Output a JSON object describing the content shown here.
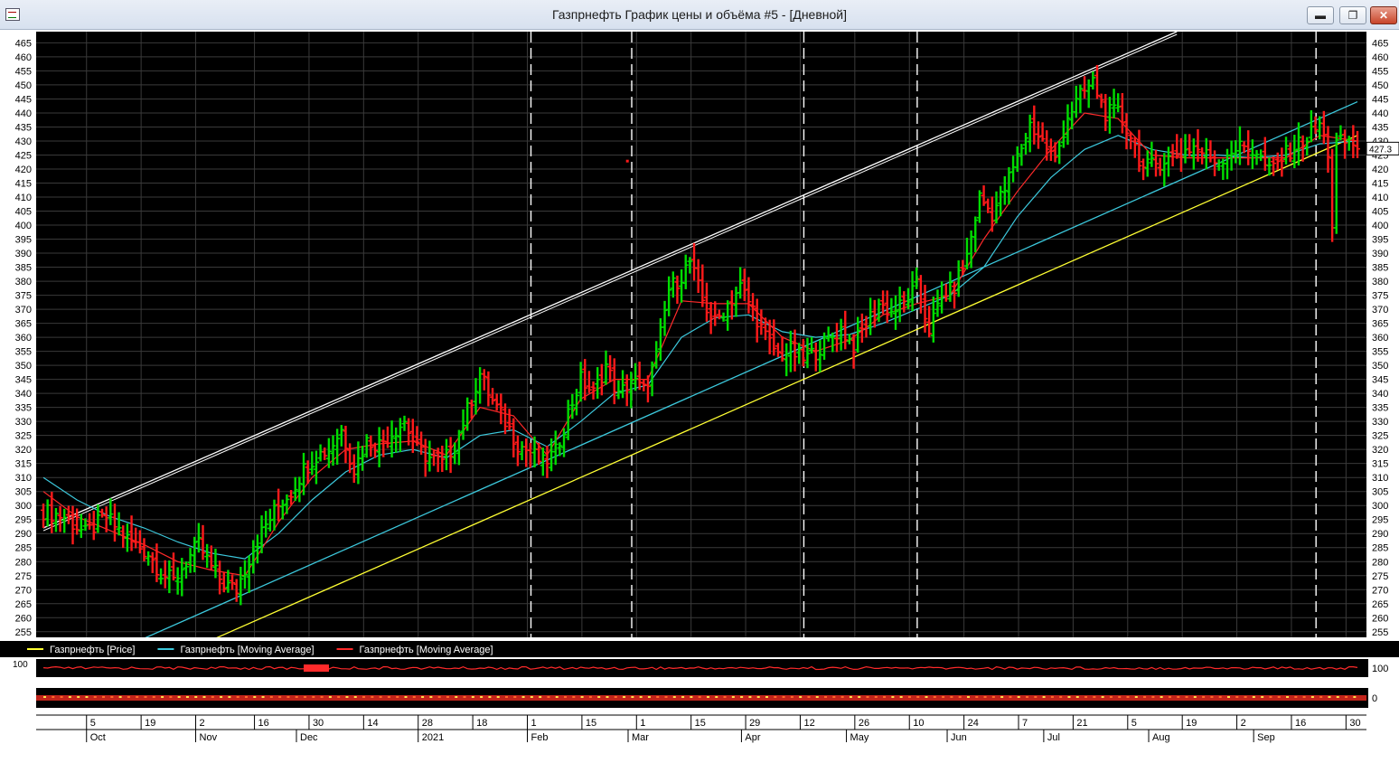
{
  "window": {
    "title": "Газпрнефть График цены и объёма #5 - [Дневной]",
    "buttons": {
      "minimize": "▬",
      "restore": "❐",
      "close": "✕"
    }
  },
  "chart_data": {
    "type": "bar",
    "subtype": "ohlc",
    "ylim": [
      253,
      469
    ],
    "y_ticks": [
      255,
      260,
      265,
      270,
      275,
      280,
      285,
      290,
      295,
      300,
      305,
      310,
      315,
      320,
      325,
      330,
      335,
      340,
      345,
      350,
      355,
      360,
      365,
      370,
      375,
      380,
      385,
      390,
      395,
      400,
      405,
      410,
      415,
      420,
      425,
      430,
      435,
      440,
      445,
      450,
      455,
      460,
      465
    ],
    "grid": true,
    "background": "#000000",
    "up_color": "#00dd00",
    "down_color": "#ff1a1a",
    "last_value_label": "427.3",
    "price_points": [
      [
        0,
        298
      ],
      [
        5,
        296
      ],
      [
        10,
        290
      ],
      [
        15,
        296
      ],
      [
        20,
        288
      ],
      [
        25,
        283
      ],
      [
        28,
        276
      ],
      [
        31,
        273
      ],
      [
        34,
        280
      ],
      [
        37,
        286
      ],
      [
        40,
        278
      ],
      [
        43,
        272
      ],
      [
        46,
        270
      ],
      [
        50,
        285
      ],
      [
        53,
        293
      ],
      [
        56,
        300
      ],
      [
        59,
        305
      ],
      [
        62,
        313
      ],
      [
        65,
        318
      ],
      [
        68,
        320
      ],
      [
        71,
        327
      ],
      [
        74,
        313
      ],
      [
        77,
        323
      ],
      [
        80,
        322
      ],
      [
        83,
        326
      ],
      [
        86,
        330
      ],
      [
        89,
        320
      ],
      [
        92,
        317
      ],
      [
        95,
        315
      ],
      [
        98,
        322
      ],
      [
        101,
        334
      ],
      [
        104,
        347
      ],
      [
        107,
        337
      ],
      [
        110,
        330
      ],
      [
        113,
        322
      ],
      [
        116,
        319
      ],
      [
        119,
        315
      ],
      [
        122,
        319
      ],
      [
        125,
        333
      ],
      [
        128,
        345
      ],
      [
        131,
        340
      ],
      [
        134,
        350
      ],
      [
        137,
        339
      ],
      [
        140,
        345
      ],
      [
        143,
        341
      ],
      [
        146,
        353
      ],
      [
        149,
        377
      ],
      [
        152,
        382
      ],
      [
        154,
        387
      ],
      [
        157,
        373
      ],
      [
        160,
        365
      ],
      [
        163,
        372
      ],
      [
        166,
        378
      ],
      [
        169,
        370
      ],
      [
        172,
        360
      ],
      [
        175,
        354
      ],
      [
        178,
        355
      ],
      [
        181,
        352
      ],
      [
        184,
        355
      ],
      [
        187,
        359
      ],
      [
        190,
        363
      ],
      [
        193,
        357
      ],
      [
        196,
        365
      ],
      [
        199,
        372
      ],
      [
        202,
        369
      ],
      [
        205,
        372
      ],
      [
        208,
        378
      ],
      [
        211,
        363
      ],
      [
        214,
        374
      ],
      [
        217,
        378
      ],
      [
        220,
        389
      ],
      [
        223,
        410
      ],
      [
        226,
        404
      ],
      [
        229,
        413
      ],
      [
        232,
        424
      ],
      [
        235,
        436
      ],
      [
        238,
        430
      ],
      [
        241,
        423
      ],
      [
        244,
        439
      ],
      [
        247,
        446
      ],
      [
        250,
        451
      ],
      [
        253,
        440
      ],
      [
        256,
        440
      ],
      [
        259,
        432
      ],
      [
        262,
        420
      ],
      [
        265,
        422
      ],
      [
        268,
        424
      ],
      [
        271,
        426
      ],
      [
        274,
        428
      ],
      [
        277,
        425
      ],
      [
        280,
        423
      ],
      [
        283,
        427
      ],
      [
        286,
        428
      ],
      [
        289,
        426
      ],
      [
        292,
        419
      ],
      [
        295,
        424
      ],
      [
        298,
        428
      ],
      [
        301,
        431
      ],
      [
        304,
        436
      ],
      [
        306,
        426
      ],
      [
        307,
        400
      ],
      [
        308,
        429
      ],
      [
        311,
        430
      ],
      [
        313,
        428
      ]
    ],
    "moving_averages": [
      {
        "name": "Газпрнефть [Moving Average]",
        "color": "#3cc8dc",
        "points": [
          [
            0,
            310
          ],
          [
            8,
            302
          ],
          [
            16,
            296
          ],
          [
            24,
            292
          ],
          [
            32,
            287
          ],
          [
            40,
            283
          ],
          [
            48,
            281
          ],
          [
            56,
            290
          ],
          [
            64,
            302
          ],
          [
            72,
            312
          ],
          [
            80,
            318
          ],
          [
            88,
            320
          ],
          [
            96,
            317
          ],
          [
            104,
            325
          ],
          [
            112,
            327
          ],
          [
            120,
            321
          ],
          [
            128,
            330
          ],
          [
            136,
            340
          ],
          [
            144,
            343
          ],
          [
            152,
            360
          ],
          [
            160,
            367
          ],
          [
            168,
            368
          ],
          [
            176,
            362
          ],
          [
            184,
            360
          ],
          [
            192,
            361
          ],
          [
            200,
            365
          ],
          [
            208,
            370
          ],
          [
            216,
            375
          ],
          [
            224,
            385
          ],
          [
            232,
            403
          ],
          [
            240,
            417
          ],
          [
            248,
            427
          ],
          [
            256,
            432
          ],
          [
            264,
            427
          ],
          [
            272,
            425
          ],
          [
            280,
            425
          ],
          [
            288,
            424
          ],
          [
            296,
            425
          ],
          [
            304,
            429
          ],
          [
            313,
            430
          ]
        ]
      },
      {
        "name": "Газпрнефть [Moving Average]",
        "color": "#ff2a2a",
        "points": [
          [
            0,
            305
          ],
          [
            8,
            296
          ],
          [
            16,
            291
          ],
          [
            24,
            286
          ],
          [
            32,
            280
          ],
          [
            40,
            277
          ],
          [
            48,
            275
          ],
          [
            56,
            294
          ],
          [
            64,
            310
          ],
          [
            72,
            320
          ],
          [
            80,
            322
          ],
          [
            88,
            323
          ],
          [
            96,
            318
          ],
          [
            104,
            335
          ],
          [
            112,
            332
          ],
          [
            120,
            318
          ],
          [
            128,
            338
          ],
          [
            136,
            345
          ],
          [
            144,
            345
          ],
          [
            152,
            373
          ],
          [
            160,
            372
          ],
          [
            168,
            372
          ],
          [
            176,
            360
          ],
          [
            184,
            355
          ],
          [
            192,
            359
          ],
          [
            200,
            368
          ],
          [
            208,
            372
          ],
          [
            216,
            375
          ],
          [
            224,
            395
          ],
          [
            232,
            412
          ],
          [
            240,
            427
          ],
          [
            248,
            440
          ],
          [
            256,
            438
          ],
          [
            264,
            425
          ],
          [
            272,
            424
          ],
          [
            280,
            424
          ],
          [
            288,
            424
          ],
          [
            296,
            424
          ],
          [
            304,
            432
          ],
          [
            313,
            430
          ]
        ]
      }
    ],
    "trendlines": [
      {
        "color": "#ffffff",
        "from": [
          0,
          292
        ],
        "to": [
          270,
          469
        ]
      },
      {
        "color": "#3cc8dc",
        "from": [
          20,
          250
        ],
        "to": [
          313,
          444
        ]
      },
      {
        "color": "#ffff33",
        "from": [
          40,
          252
        ],
        "to": [
          313,
          432
        ]
      }
    ],
    "x_tick_labels": [
      {
        "i": 12,
        "label": "5"
      },
      {
        "i": 25,
        "label": "19"
      },
      {
        "i": 38,
        "label": "2"
      },
      {
        "i": 52,
        "label": "16"
      },
      {
        "i": 65,
        "label": "30"
      },
      {
        "i": 78,
        "label": "14"
      },
      {
        "i": 91,
        "label": "28"
      },
      {
        "i": 104,
        "label": "18"
      },
      {
        "i": 117,
        "label": "1"
      },
      {
        "i": 130,
        "label": "15"
      },
      {
        "i": 143,
        "label": "1"
      },
      {
        "i": 156,
        "label": "15"
      },
      {
        "i": 169,
        "label": "29"
      },
      {
        "i": 182,
        "label": "12"
      },
      {
        "i": 195,
        "label": "26"
      },
      {
        "i": 208,
        "label": "10"
      },
      {
        "i": 221,
        "label": "24"
      },
      {
        "i": 234,
        "label": "7"
      },
      {
        "i": 247,
        "label": "21"
      },
      {
        "i": 260,
        "label": "5"
      },
      {
        "i": 273,
        "label": "19"
      },
      {
        "i": 286,
        "label": "2"
      },
      {
        "i": 299,
        "label": "16"
      },
      {
        "i": 312,
        "label": "30"
      }
    ],
    "x_period_labels": [
      {
        "i": 12,
        "label": "Oct"
      },
      {
        "i": 38,
        "label": "Nov"
      },
      {
        "i": 62,
        "label": "Dec"
      },
      {
        "i": 91,
        "label": "2021"
      },
      {
        "i": 117,
        "label": "Feb"
      },
      {
        "i": 141,
        "label": "Mar"
      },
      {
        "i": 168,
        "label": "Apr"
      },
      {
        "i": 193,
        "label": "May"
      },
      {
        "i": 217,
        "label": "Jun"
      },
      {
        "i": 240,
        "label": "Jul"
      },
      {
        "i": 265,
        "label": "Aug"
      },
      {
        "i": 290,
        "label": "Sep"
      }
    ],
    "dashed_vlines": [
      117,
      141,
      182,
      209,
      304
    ],
    "legend": [
      {
        "label": "Газпрнефть [Price]",
        "color": "#ffff33"
      },
      {
        "label": "Газпрнефть [Moving Average]",
        "color": "#3cc8dc"
      },
      {
        "label": "Газпрнефть [Moving Average]",
        "color": "#ff2a2a"
      }
    ],
    "legend_position": "bottom-left",
    "indicator_panels": [
      {
        "right_label": "100",
        "left_label": "100"
      },
      {
        "right_label": "0",
        "left_label": ""
      }
    ]
  }
}
